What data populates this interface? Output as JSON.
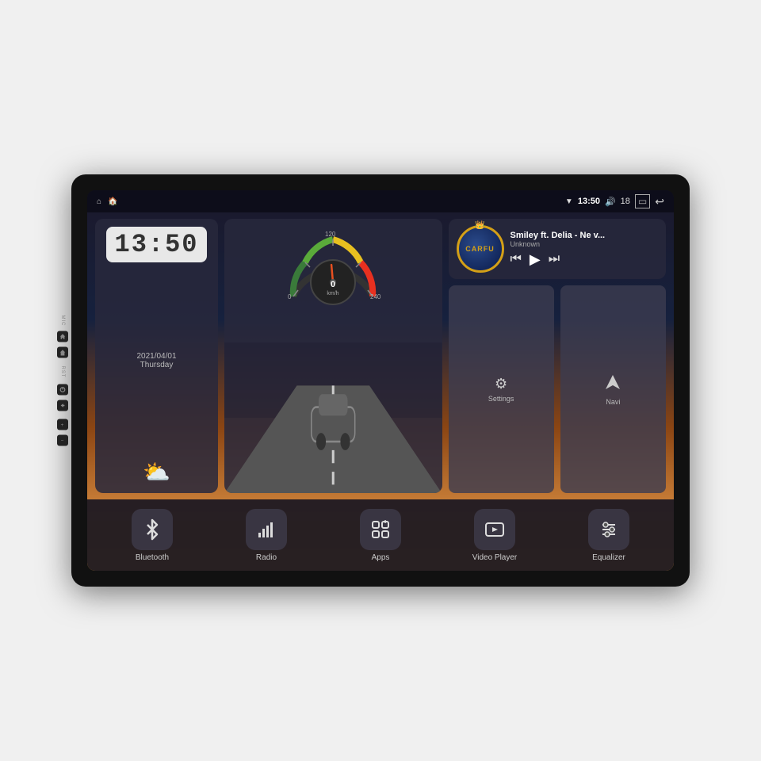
{
  "device": {
    "outer_bg": "#111"
  },
  "status_bar": {
    "left_icon_home": "⌂",
    "left_icon_house": "🏠",
    "time": "13:50",
    "volume_icon": "🔊",
    "volume_level": "18",
    "battery_icon": "▭",
    "back_icon": "↩",
    "wifi_icon": "▼",
    "mic_label": "MIC",
    "rst_label": "RST"
  },
  "clock_widget": {
    "time": "13:50",
    "date": "2021/04/01",
    "day": "Thursday"
  },
  "speedometer": {
    "speed": "0",
    "unit": "km/h",
    "max": "240"
  },
  "music": {
    "song_title": "Smiley ft. Delia - Ne v...",
    "artist": "Unknown",
    "album_label": "CARFU"
  },
  "app_buttons_upper": [
    {
      "id": "settings",
      "label": "Settings",
      "icon": "⚙"
    },
    {
      "id": "navi",
      "label": "Navi",
      "icon": "▲"
    }
  ],
  "app_bar": [
    {
      "id": "bluetooth",
      "label": "Bluetooth",
      "icon": "bluetooth"
    },
    {
      "id": "radio",
      "label": "Radio",
      "icon": "radio"
    },
    {
      "id": "apps",
      "label": "Apps",
      "icon": "apps"
    },
    {
      "id": "video_player",
      "label": "Video Player",
      "icon": "video"
    },
    {
      "id": "equalizer",
      "label": "Equalizer",
      "icon": "equalizer"
    }
  ],
  "side_buttons": [
    {
      "id": "power",
      "icon": "⏻"
    },
    {
      "id": "home",
      "icon": "⌂"
    },
    {
      "id": "back",
      "icon": "↩"
    },
    {
      "id": "vol_up",
      "icon": "+"
    },
    {
      "id": "vol_down",
      "icon": "−"
    }
  ]
}
